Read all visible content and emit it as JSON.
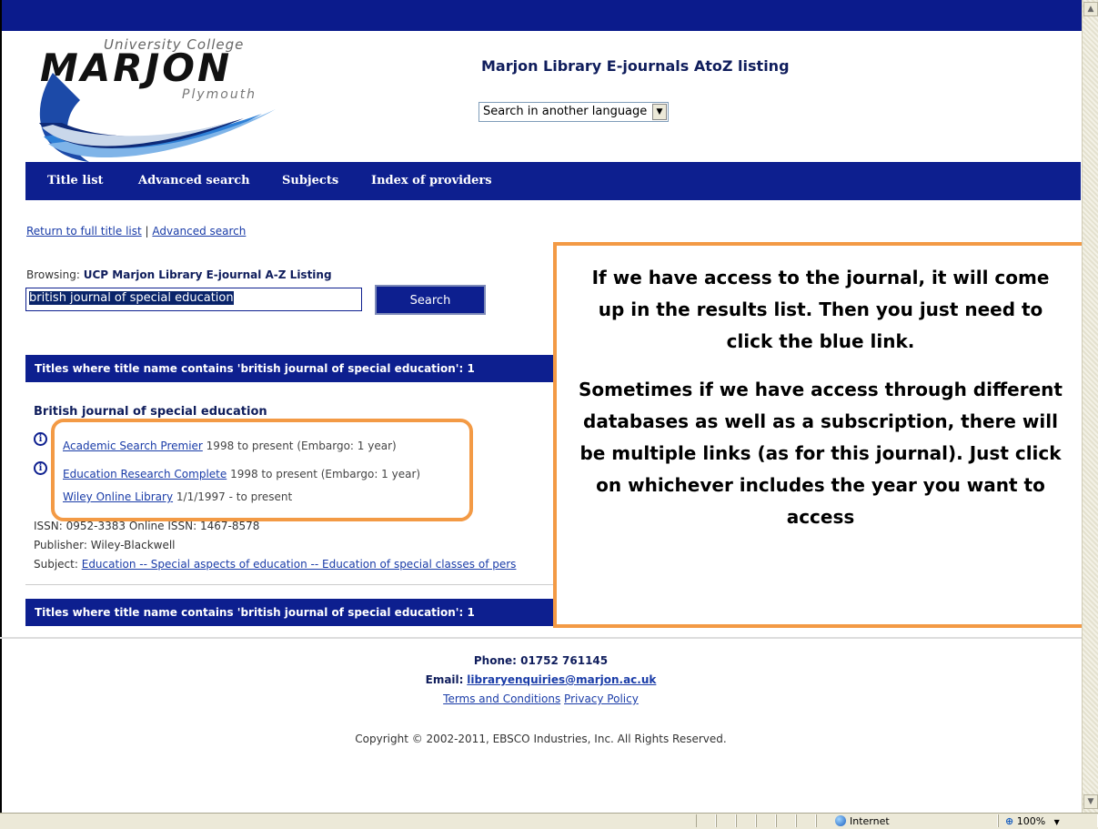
{
  "header": {
    "logo": {
      "top": "University College",
      "main": "MARJON",
      "bottom": "Plymouth"
    },
    "site_title": "Marjon Library E-journals AtoZ listing",
    "language_select": "Search in another language"
  },
  "nav": {
    "items": [
      "Title list",
      "Advanced search",
      "Subjects",
      "Index of providers"
    ]
  },
  "crumbs": {
    "return_link": "Return to full title list",
    "separator": "|",
    "advanced_link": "Advanced search"
  },
  "search": {
    "browsing_label": "Browsing:",
    "browsing_value": "UCP Marjon Library E-journal A-Z Listing",
    "query": "british journal of special education",
    "button": "Search"
  },
  "results": {
    "bar_text": "Titles where title name contains 'british journal of special education': 1",
    "title": "British journal of special education",
    "providers": [
      {
        "name": "Academic Search Premier",
        "coverage": "1998 to present (Embargo: 1 year)",
        "has_info_icon": true
      },
      {
        "name": "Education Research Complete",
        "coverage": "1998 to present (Embargo: 1 year)",
        "has_info_icon": true
      },
      {
        "name": "Wiley Online Library",
        "coverage": "1/1/1997 - to present",
        "has_info_icon": false
      }
    ],
    "issn": "ISSN: 0952-3383 Online ISSN: 1467-8578",
    "publisher": "Publisher: Wiley-Blackwell",
    "subject_label": "Subject:",
    "subject_link": "Education -- Special aspects of education -- Education of special classes of pers"
  },
  "annotation": {
    "paragraph1": "If we have access to the journal, it will come up in the results list. Then you just need to click the blue link.",
    "paragraph2": "Sometimes if we have access through different databases as well as a subscription, there will be multiple links (as for this journal). Just click on whichever includes the year you want to access",
    "border_color": "#f39a45"
  },
  "footer": {
    "phone": "Phone: 01752 761145",
    "email_label": "Email:",
    "email": "libraryenquiries@marjon.ac.uk",
    "terms": "Terms and Conditions",
    "privacy": "Privacy Policy",
    "copyright": "Copyright © 2002-2011, EBSCO Industries, Inc. All Rights Reserved."
  },
  "statusbar": {
    "zone": "Internet",
    "zoom": "100%"
  },
  "colors": {
    "navy": "#0d1f8f",
    "link": "#1a3ca8",
    "accent": "#f39a45"
  },
  "icons": [
    "info-icon",
    "globe-icon",
    "zoom-icon",
    "dropdown-arrow-icon",
    "scroll-up-icon",
    "scroll-down-icon"
  ]
}
